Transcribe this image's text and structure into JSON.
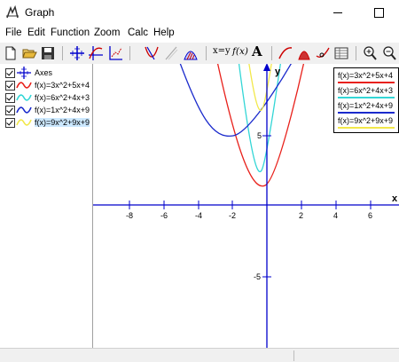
{
  "window": {
    "title": "Graph"
  },
  "menu": [
    "File",
    "Edit",
    "Function",
    "Zoom",
    "Calc",
    "Help"
  ],
  "toolbar": {
    "buttons": [
      "new-icon",
      "open-icon",
      "save-icon",
      "axes-icon",
      "insert-function-icon",
      "insert-point-series-icon",
      "tangent-icon",
      "shade-icon",
      "shading-icon",
      "evaluate-icon",
      "table-icon",
      "zoom-in-icon",
      "zoom-out-icon"
    ],
    "text_buttons": {
      "xy": "x=y",
      "fx": "f(x)",
      "a": "A"
    }
  },
  "sidebar": {
    "items": [
      {
        "label": "Axes",
        "checked": true,
        "type": "axes",
        "color": "#0000cc"
      },
      {
        "label": "f(x)=3x^2+5x+4",
        "checked": true,
        "type": "function",
        "color": "#e8201a"
      },
      {
        "label": "f(x)=6x^2+4x+3",
        "checked": true,
        "type": "function",
        "color": "#33d6d6"
      },
      {
        "label": "f(x)=1x^2+4x+9",
        "checked": true,
        "type": "function",
        "color": "#1a2acc"
      },
      {
        "label": "f(x)=9x^2+9x+9",
        "checked": true,
        "type": "function",
        "color": "#f2e84a",
        "selected": true
      }
    ]
  },
  "legend": [
    {
      "label": "f(x)=3x^2+5x+4",
      "color": "#e8201a"
    },
    {
      "label": "f(x)=6x^2+4x+3",
      "color": "#33d6d6"
    },
    {
      "label": "f(x)=1x^2+4x+9",
      "color": "#1a2acc"
    },
    {
      "label": "f(x)=9x^2+9x+9",
      "color": "#f2e84a"
    }
  ],
  "graph": {
    "x_label": "x",
    "y_label": "y",
    "x_ticks": [
      "-8",
      "-6",
      "-4",
      "-2",
      "2",
      "4",
      "6"
    ],
    "y_ticks": [
      "5",
      "-5"
    ],
    "axis_color": "#0000cc"
  }
}
